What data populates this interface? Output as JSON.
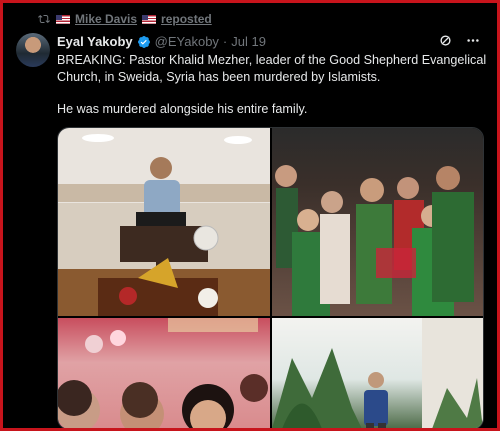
{
  "repost": {
    "label": "Mike Davis",
    "suffix": "reposted",
    "icon": "repost-icon"
  },
  "author": {
    "name": "Eyal Yakoby",
    "handle": "@EYakoby",
    "separator": "·",
    "date": "Jul 19"
  },
  "post": {
    "paragraph1": "BREAKING: Pastor Khalid Mezher, leader of the Good Shepherd Evangelical Church, in Sweida, Syria has been murdered by Islamists.",
    "paragraph2": "He was murdered alongside his entire family."
  },
  "colors": {
    "accent": "#1d9bf0",
    "frame": "#c8141c",
    "text": "#e7e9ea",
    "muted": "#71767b"
  }
}
